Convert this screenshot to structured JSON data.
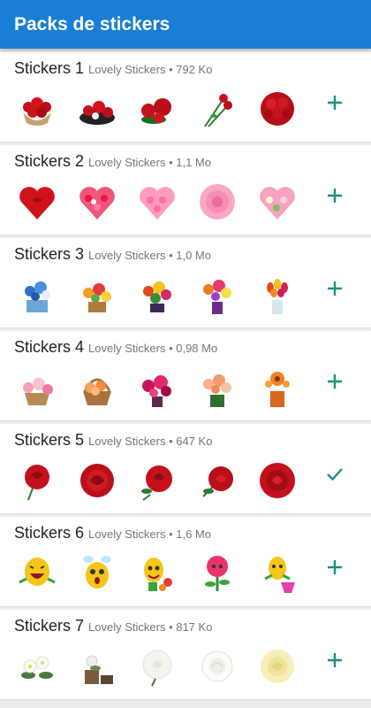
{
  "appbar": {
    "title": "Packs de stickers"
  },
  "colors": {
    "appbar": "#1a7fd4",
    "action": "#1e8e84"
  },
  "packs": [
    {
      "name": "Stickers 1",
      "meta": "Lovely Stickers • 792 Ko",
      "action": "add-icon",
      "stickers": [
        "red-rose-bouquet",
        "rose-box",
        "red-roses",
        "rose-stems",
        "red-rose-ball"
      ]
    },
    {
      "name": "Stickers 2",
      "meta": "Lovely Stickers • 1,1 Mo",
      "action": "add-icon",
      "stickers": [
        "red-rose-heart",
        "pink-carnation-heart",
        "pink-rose-heart",
        "pink-rose-bloom",
        "pink-flower-heart"
      ]
    },
    {
      "name": "Stickers 3",
      "meta": "Lovely Stickers • 1,0 Mo",
      "action": "add-icon",
      "stickers": [
        "blue-flower-basket",
        "mixed-bouquet",
        "garden-bouquet",
        "vase-bouquet",
        "tulip-vase"
      ]
    },
    {
      "name": "Stickers 4",
      "meta": "Lovely Stickers • 0,98 Mo",
      "action": "add-icon",
      "stickers": [
        "pink-basket",
        "orange-rose-basket",
        "magenta-bouquet",
        "peach-vase",
        "orange-gerbera-pot"
      ]
    },
    {
      "name": "Stickers 5",
      "meta": "Lovely Stickers • 647 Ko",
      "action": "check-icon",
      "stickers": [
        "red-rose-1",
        "red-rose-2",
        "red-rose-3",
        "red-rose-4",
        "red-rose-5"
      ]
    },
    {
      "name": "Stickers 6",
      "meta": "Lovely Stickers • 1,6 Mo",
      "action": "add-icon",
      "stickers": [
        "laughing-emoji",
        "bee-emoji",
        "emoji-with-flowers",
        "rose-character",
        "emoji-with-basket"
      ]
    },
    {
      "name": "Stickers 7",
      "meta": "Lovely Stickers • 817 Ko",
      "action": "add-icon",
      "stickers": [
        "white-frangipani",
        "flower-pots",
        "white-rose",
        "white-rose-2",
        "cream-rose"
      ]
    }
  ]
}
